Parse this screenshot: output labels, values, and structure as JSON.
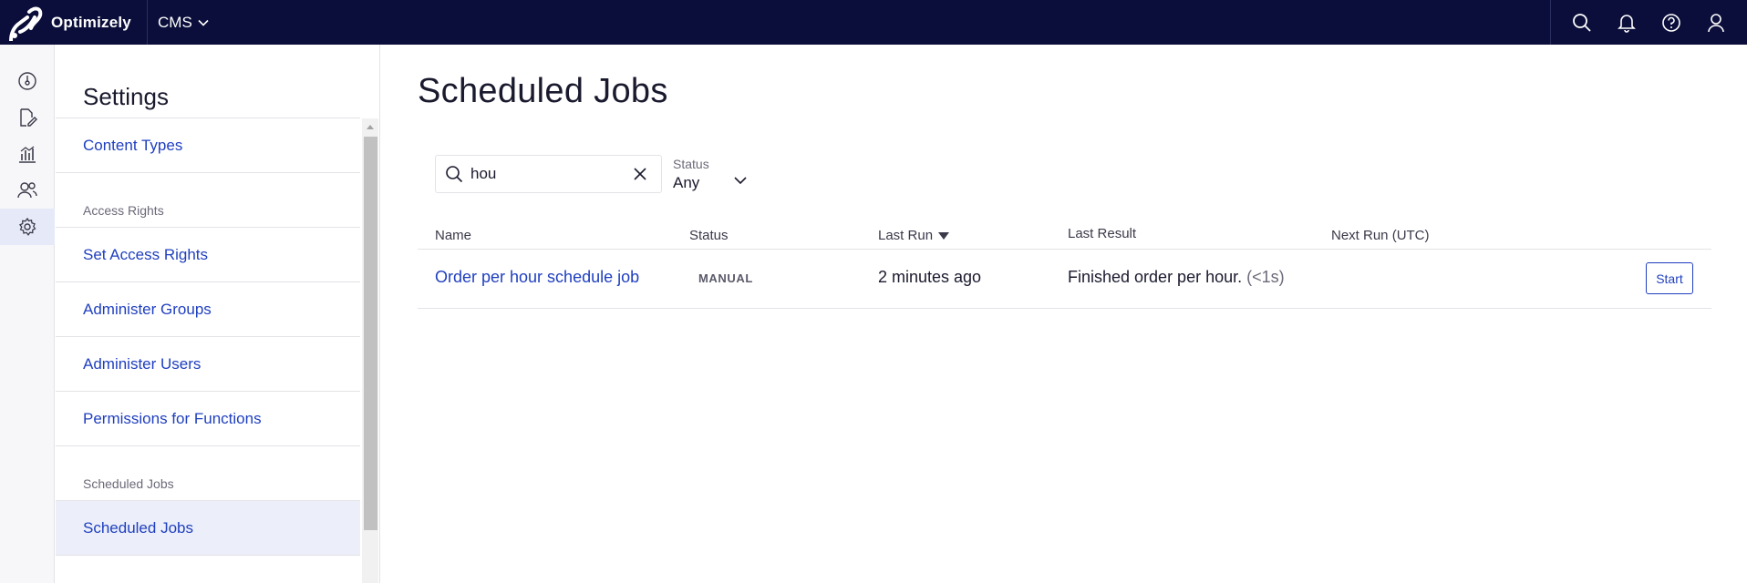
{
  "topbar": {
    "brand": "Optimizely",
    "product": "CMS",
    "icons": [
      "search-icon",
      "bell-icon",
      "help-icon",
      "user-icon"
    ]
  },
  "rail": {
    "icons": [
      "dashboard-icon",
      "edit-icon",
      "analytics-icon",
      "people-icon",
      "settings-icon"
    ],
    "active": "settings-icon"
  },
  "settings": {
    "title": "Settings",
    "nav": [
      {
        "type": "link",
        "label": "Content Types"
      },
      {
        "type": "group",
        "label": "Access Rights"
      },
      {
        "type": "link",
        "label": "Set Access Rights"
      },
      {
        "type": "link",
        "label": "Administer Groups"
      },
      {
        "type": "link",
        "label": "Administer Users"
      },
      {
        "type": "link",
        "label": "Permissions for Functions"
      },
      {
        "type": "group",
        "label": "Scheduled Jobs"
      },
      {
        "type": "link",
        "label": "Scheduled Jobs",
        "selected": true
      }
    ]
  },
  "main": {
    "title": "Scheduled Jobs",
    "search": {
      "value": "hou",
      "placeholder": ""
    },
    "status_filter": {
      "label": "Status",
      "value": "Any"
    },
    "columns": {
      "name": "Name",
      "status": "Status",
      "last_run": "Last Run",
      "last_result": "Last Result",
      "next_run": "Next Run (UTC)"
    },
    "sort": {
      "column": "Last Run",
      "direction": "descending"
    },
    "rows": [
      {
        "name": "Order per hour schedule job",
        "status": "MANUAL",
        "last_run": "2 minutes ago",
        "last_result": "Finished order per hour.",
        "duration": "(<1s)",
        "next_run": "",
        "action": "Start"
      }
    ]
  },
  "colors": {
    "topbar_bg": "#0b0e3a",
    "link": "#1f3fbf",
    "logo_accent": "#3b5bfd"
  }
}
